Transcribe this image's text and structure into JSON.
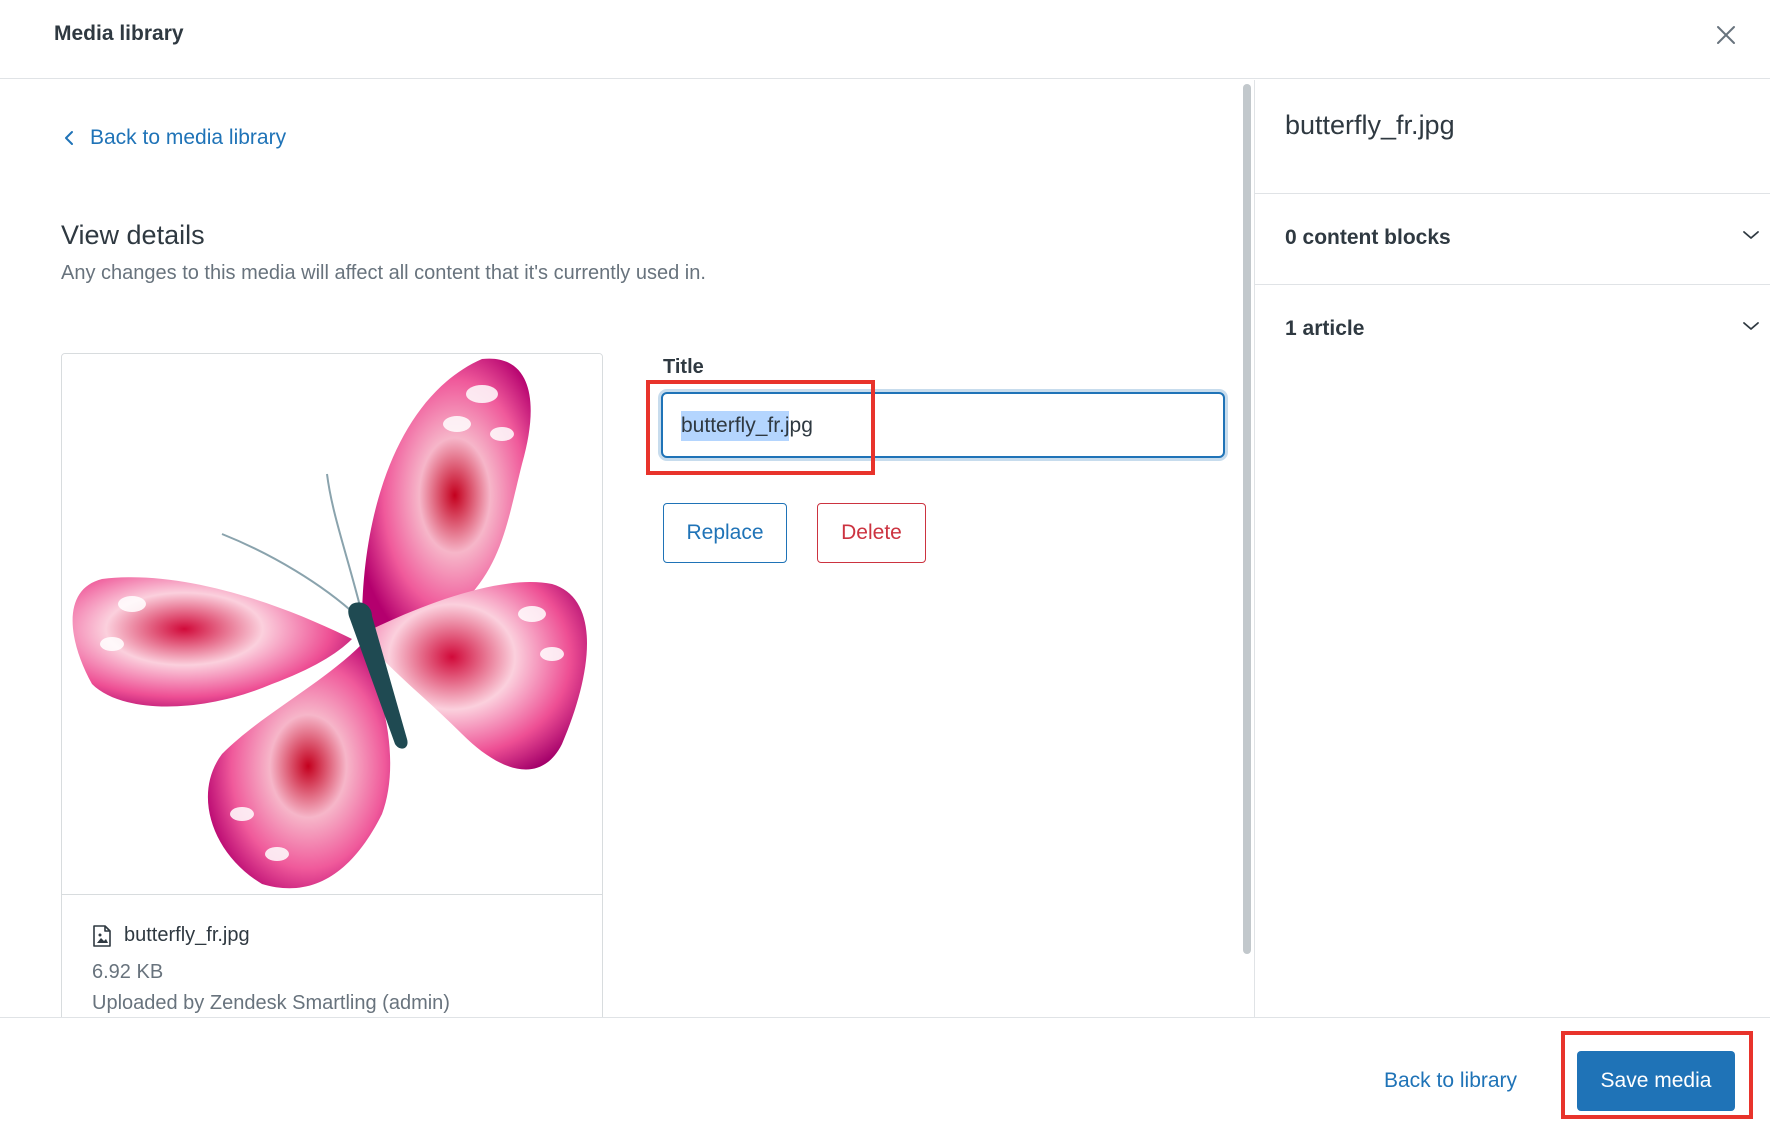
{
  "header": {
    "title": "Media library",
    "close_icon": "close-icon"
  },
  "content": {
    "back_link": "Back to media library",
    "back_icon": "chevron-left-icon",
    "section_title": "View details",
    "section_description": "Any changes to this media will affect all content that it's currently used in.",
    "preview": {
      "file_icon": "image-file-icon",
      "file_name": "butterfly_fr.jpg",
      "file_size": "6.92 KB",
      "uploaded_by": "Uploaded by Zendesk Smartling (admin)"
    },
    "title_field": {
      "label": "Title",
      "value": "butterfly_fr.jpg",
      "selected_text": "butterfly_fr"
    },
    "buttons": {
      "replace": "Replace",
      "delete": "Delete"
    }
  },
  "side_panel": {
    "file_name": "butterfly_fr.jpg",
    "accordions": [
      {
        "label": "0 content blocks",
        "icon": "chevron-down-icon"
      },
      {
        "label": "1 article",
        "icon": "chevron-down-icon"
      }
    ]
  },
  "footer": {
    "back_to_library": "Back to library",
    "save": "Save media"
  },
  "colors": {
    "accent": "#1f73b7",
    "danger": "#cc3340",
    "annotation": "#e8332b",
    "text": "#2f3941",
    "muted": "#68737d",
    "border": "#d8dcde"
  }
}
